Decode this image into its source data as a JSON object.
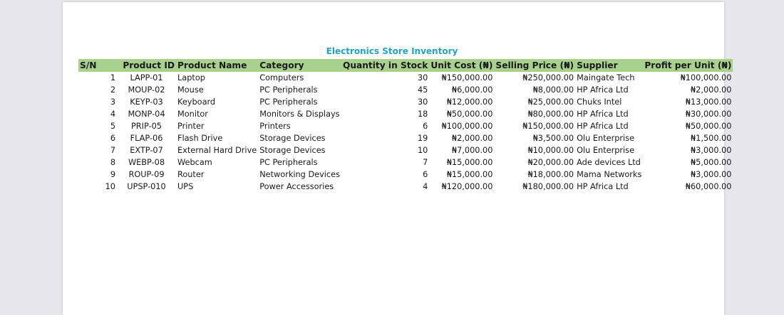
{
  "document": {
    "title": "Electronics Store Inventory"
  },
  "table": {
    "headers": {
      "sn": "S/N",
      "product_id": "Product ID",
      "product_name": "Product Name",
      "category": "Category",
      "quantity": "Quantity in Stock",
      "unit_cost": "Unit Cost (₦)",
      "selling_price": "Selling Price (₦)",
      "supplier": "Supplier",
      "profit": "Profit per Unit (₦)"
    },
    "rows": [
      {
        "sn": "1",
        "product_id": "LAPP-01",
        "product_name": "Laptop",
        "category": "Computers",
        "quantity": "30",
        "unit_cost": "₦150,000.00",
        "selling_price": "₦250,000.00",
        "supplier": "Maingate Tech",
        "profit": "₦100,000.00"
      },
      {
        "sn": "2",
        "product_id": "MOUP-02",
        "product_name": "Mouse",
        "category": "PC Peripherals",
        "quantity": "45",
        "unit_cost": "₦6,000.00",
        "selling_price": "₦8,000.00",
        "supplier": "HP Africa Ltd",
        "profit": "₦2,000.00"
      },
      {
        "sn": "3",
        "product_id": "KEYP-03",
        "product_name": "Keyboard",
        "category": "PC Peripherals",
        "quantity": "30",
        "unit_cost": "₦12,000.00",
        "selling_price": "₦25,000.00",
        "supplier": "Chuks Intel",
        "profit": "₦13,000.00"
      },
      {
        "sn": "4",
        "product_id": "MONP-04",
        "product_name": "Monitor",
        "category": "Monitors & Displays",
        "quantity": "18",
        "unit_cost": "₦50,000.00",
        "selling_price": "₦80,000.00",
        "supplier": "HP Africa Ltd",
        "profit": "₦30,000.00"
      },
      {
        "sn": "5",
        "product_id": "PRIP-05",
        "product_name": "Printer",
        "category": "Printers",
        "quantity": "6",
        "unit_cost": "₦100,000.00",
        "selling_price": "₦150,000.00",
        "supplier": "HP Africa Ltd",
        "profit": "₦50,000.00"
      },
      {
        "sn": "6",
        "product_id": "FLAP-06",
        "product_name": "Flash Drive",
        "category": "Storage Devices",
        "quantity": "19",
        "unit_cost": "₦2,000.00",
        "selling_price": "₦3,500.00",
        "supplier": "Olu Enterprise",
        "profit": "₦1,500.00"
      },
      {
        "sn": "7",
        "product_id": "EXTP-07",
        "product_name": "External Hard Drive",
        "category": "Storage Devices",
        "quantity": "10",
        "unit_cost": "₦7,000.00",
        "selling_price": "₦10,000.00",
        "supplier": "Olu Enterprise",
        "profit": "₦3,000.00"
      },
      {
        "sn": "8",
        "product_id": "WEBP-08",
        "product_name": "Webcam",
        "category": "PC Peripherals",
        "quantity": "7",
        "unit_cost": "₦15,000.00",
        "selling_price": "₦20,000.00",
        "supplier": "Ade devices Ltd",
        "profit": "₦5,000.00"
      },
      {
        "sn": "9",
        "product_id": "ROUP-09",
        "product_name": "Router",
        "category": "Networking Devices",
        "quantity": "6",
        "unit_cost": "₦15,000.00",
        "selling_price": "₦18,000.00",
        "supplier": "Mama Networks",
        "profit": "₦3,000.00"
      },
      {
        "sn": "10",
        "product_id": "UPSP-010",
        "product_name": "UPS",
        "category": "Power Accessories",
        "quantity": "4",
        "unit_cost": "₦120,000.00",
        "selling_price": "₦180,000.00",
        "supplier": "HP Africa Ltd",
        "profit": "₦60,000.00"
      }
    ]
  },
  "colors": {
    "title": "#1fa5c4",
    "header_fill": "#a9d18e",
    "page": "#ffffff",
    "background": "#e7e6ea"
  }
}
